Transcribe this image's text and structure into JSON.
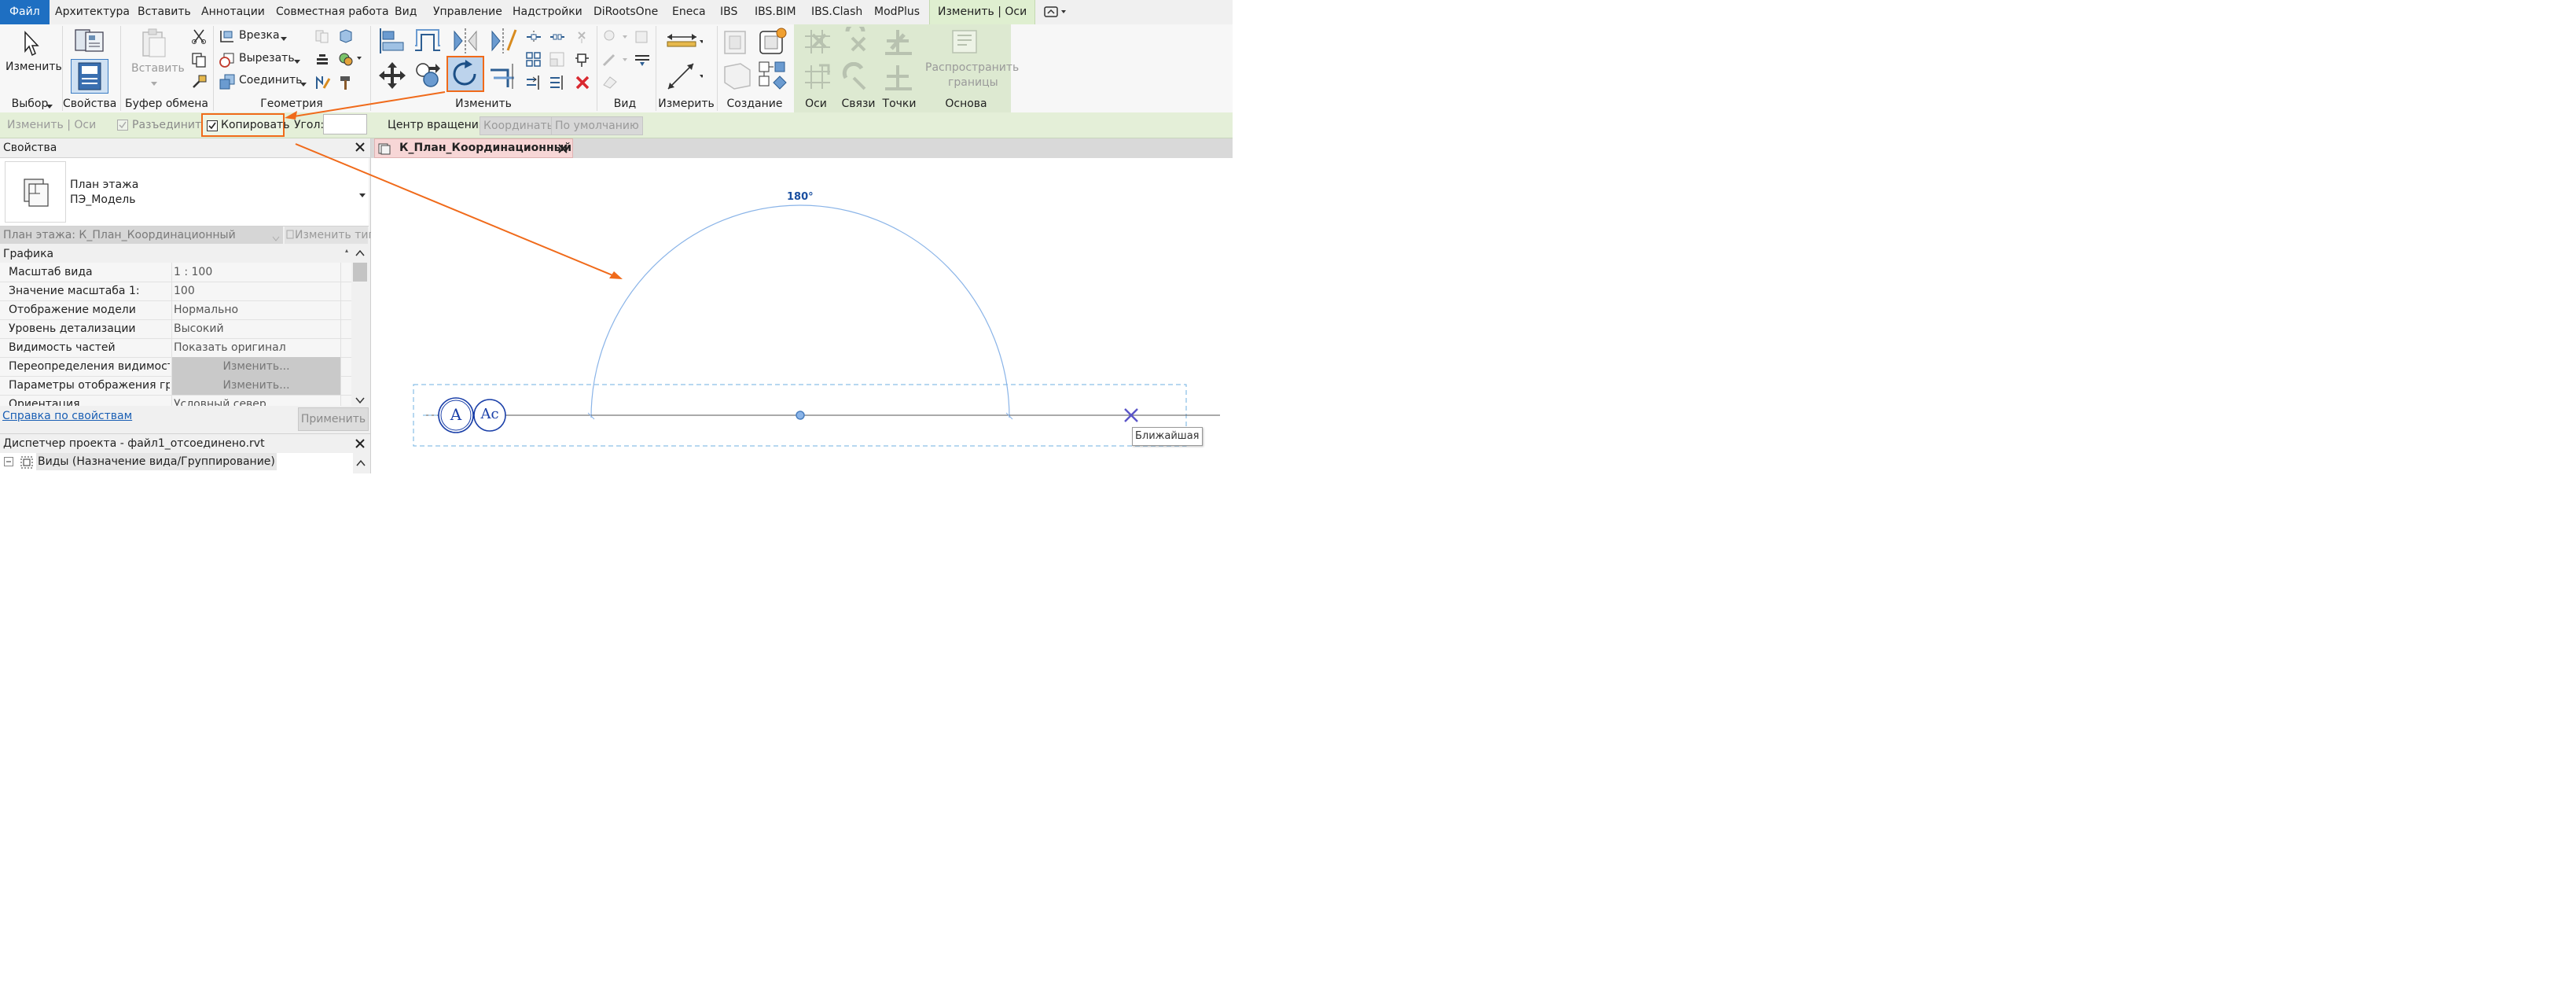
{
  "menu": {
    "file": "Файл",
    "items": [
      "Архитектура",
      "Вставить",
      "Аннотации",
      "Совместная работа",
      "Вид",
      "Управление",
      "Надстройки",
      "DiRootsOne",
      "Eneca",
      "IBS",
      "IBS.BIM",
      "IBS.Clash",
      "ModPlus"
    ],
    "active_tab": "Изменить | Оси"
  },
  "ribbon": {
    "modify_label": "Изменить",
    "select_panel": "Выбор",
    "properties_panel": "Свойства",
    "clipboard_panel": "Буфер обмена",
    "paste_label": "Вставить",
    "geometry_panel": "Геометрия",
    "cope_label": "Врезка",
    "cut_label": "Вырезать",
    "join_label": "Соединить",
    "modify_panel": "Изменить",
    "view_panel": "Вид",
    "measure_panel": "Измерить",
    "create_panel": "Создание",
    "grids_panel": "Оси",
    "links_panel": "Связи",
    "points_panel": "Точки",
    "basis_panel": "Основа",
    "propagate_label_1": "Распространить",
    "propagate_label_2": "границы"
  },
  "options_bar": {
    "context": "Изменить | Оси",
    "disjoin_label": "Разъединить",
    "copy_label": "Копировать",
    "copy_checked": true,
    "angle_label": "Угол:",
    "angle_value": "",
    "center_label": "Центр вращения:",
    "coords_button": "Координаты",
    "default_button": "По умолчанию"
  },
  "properties": {
    "title": "Свойства",
    "type_line1": "План этажа",
    "type_line2": "ПЭ_Модель",
    "instance_selector": "План этажа: К_План_Координационный",
    "edit_type": "Изменить тип",
    "section": "Графика",
    "rows": [
      {
        "name": "Масштаб вида",
        "value": "1 : 100"
      },
      {
        "name": "Значение масштаба    1:",
        "value": "100"
      },
      {
        "name": "Отображение модели",
        "value": "Нормально"
      },
      {
        "name": "Уровень детализации",
        "value": "Высокий"
      },
      {
        "name": "Видимость частей",
        "value": "Показать оригинал"
      },
      {
        "name": "Переопределения видимости...",
        "value": "Изменить..."
      },
      {
        "name": "Параметры отображения гра...",
        "value": "Изменить..."
      },
      {
        "name": "Ориентация",
        "value": "Условный север"
      }
    ],
    "help_link": "Справка по свойствам",
    "apply_button": "Применить"
  },
  "project_browser": {
    "title": "Диспетчер проекта - файл1_отсоединено.rvt",
    "root": "Виды (Назначение вида/Группирование)"
  },
  "view": {
    "tab_title": "К_План_Координационный",
    "angle_readout": "180°",
    "grid_bubble_1": "A",
    "grid_bubble_2": "Aс",
    "snap_tooltip": "Ближайшая"
  },
  "colors": {
    "accent_blue": "#1e6fc2",
    "highlight_orange": "#f06a1a",
    "contextual_green": "#dde9d1",
    "grid_blue": "#1a3fa8",
    "rotate_arc": "#8ab4e8"
  }
}
